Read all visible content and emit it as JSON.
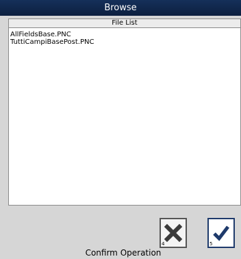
{
  "window": {
    "title": "Browse"
  },
  "file_list": {
    "header": "File List",
    "items": [
      "AllFieldsBase.PNC",
      "TuttiCampiBasePost.PNC"
    ]
  },
  "buttons": {
    "cancel": {
      "number": "4",
      "icon": "x-mark-icon"
    },
    "confirm": {
      "number": "5",
      "icon": "checkmark-icon"
    }
  },
  "status": {
    "text": "Confirm Operation"
  },
  "colors": {
    "titlebar": "#0f2447",
    "panel": "#d6d6d6",
    "confirm_check": "#1e3a6b",
    "cancel_x": "#3a3a3a"
  }
}
